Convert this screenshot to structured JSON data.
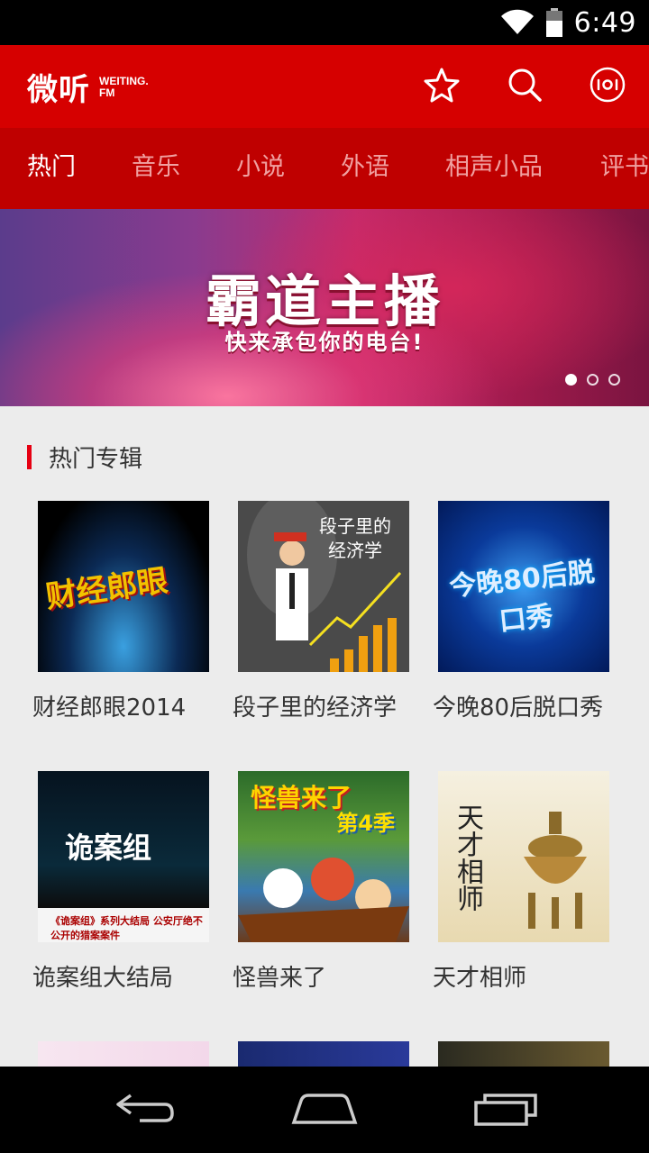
{
  "status_bar": {
    "time": "6:49"
  },
  "header": {
    "logo_main": "微听",
    "logo_sub_line1": "WEITING.",
    "logo_sub_line2": "FM",
    "accent_color": "#d60000"
  },
  "tabs": [
    {
      "label": "热门",
      "active": true
    },
    {
      "label": "音乐",
      "active": false
    },
    {
      "label": "小说",
      "active": false
    },
    {
      "label": "外语",
      "active": false
    },
    {
      "label": "相声小品",
      "active": false
    },
    {
      "label": "评书",
      "active": false
    }
  ],
  "banner": {
    "title": "霸道主播",
    "subtitle": "快来承包你的电台!",
    "page_count": 3,
    "current_page": 1
  },
  "section": {
    "title": "热门专辑"
  },
  "albums": [
    {
      "name": "财经郎眼2014",
      "cover_text": "财经郎眼"
    },
    {
      "name": "段子里的经济学",
      "cover_text": "段子里的经济学"
    },
    {
      "name": "今晚80后脱口秀",
      "cover_text": "今晚80后脱口秀"
    },
    {
      "name": "诡案组大结局",
      "cover_text": "诡案组",
      "cover_text2": "《诡案组》系列大结局 公安厅绝不公开的猎案案件"
    },
    {
      "name": "怪兽来了",
      "cover_text": "怪兽来了",
      "cover_text2": "第4季"
    },
    {
      "name": "天才相师",
      "cover_text": "天才相师"
    }
  ],
  "icons": {
    "favorite": "star-icon",
    "search": "search-icon",
    "radio": "radio-icon",
    "back": "back-icon",
    "home": "home-icon",
    "recents": "recents-icon"
  }
}
